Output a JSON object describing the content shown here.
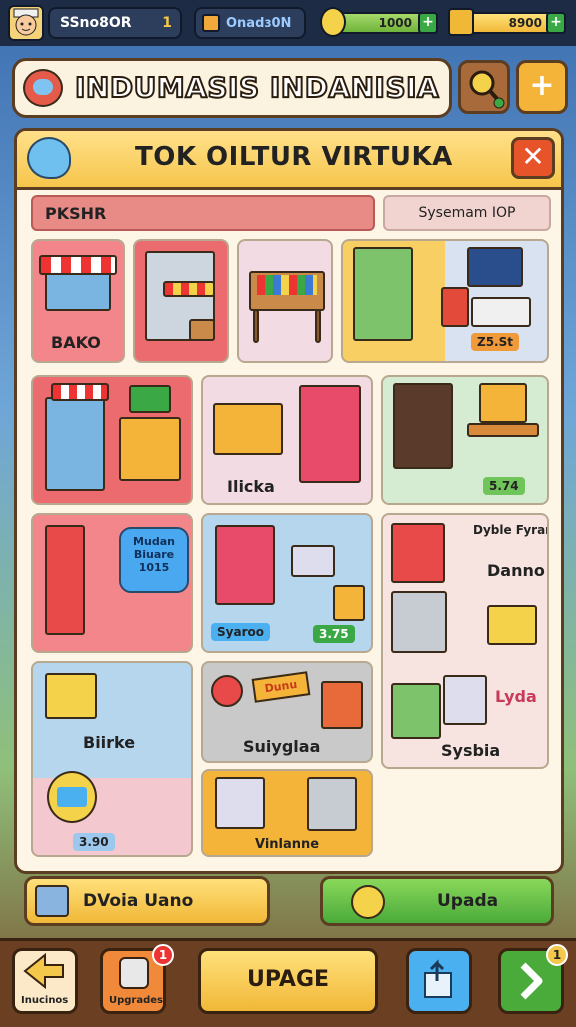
{
  "status_bar": {
    "player_name": "SSno8OR",
    "player_level": "1",
    "currency_label": "Onadɜ0N",
    "coins_value": "1000",
    "gold_value": "8900",
    "plus_label": "+"
  },
  "header": {
    "title": "INDUMASIS INDANISIA",
    "add_label": "+"
  },
  "panel": {
    "title": "TOK OILTUR VIRTUKA",
    "close_label": "✕",
    "tab_left": "PKSHR",
    "tab_right": "Sysemam IOP"
  },
  "cards": {
    "c1_label": "BAKO",
    "c3_price": "Z5.St",
    "c6_label": "Ilicka",
    "c8_price": "5.74",
    "c9_bubble": "Mudan Biuare 1015",
    "c10_tag": "Syaroo",
    "c10_price": "3.75",
    "c11_title": "Dyble Fyran",
    "c11_label": "Danno",
    "c11_pink": "Lyda",
    "c11_label2": "Sysbia",
    "c12_label": "Biirke",
    "c12_price": "3.90",
    "c13_sign": "Dunu",
    "c13_label": "Suiyglaa",
    "c14_label": "Vinlanne"
  },
  "actions": {
    "left_label": "DVoia Uano",
    "right_label": "Upada"
  },
  "nav": {
    "back_label": "Inucinos",
    "upgrades_label": "Upgrades",
    "upgrades_badge": "1",
    "upgrade_label": "UPAGE",
    "next_badge": "1"
  }
}
